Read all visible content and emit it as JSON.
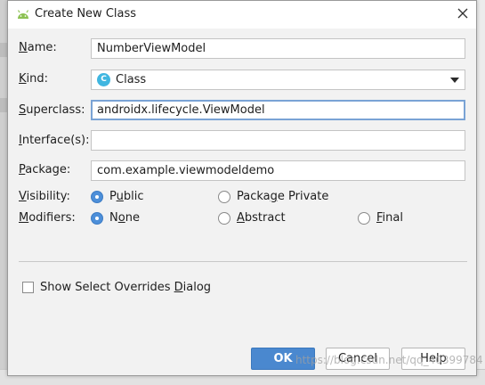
{
  "dialog": {
    "title": "Create New Class",
    "icon": "android-icon",
    "close_icon": "close-icon"
  },
  "form": {
    "name": {
      "label_u": "N",
      "label_rest": "ame:",
      "value": "NumberViewModel"
    },
    "kind": {
      "label_u": "K",
      "label_rest": "ind:",
      "value": "Class",
      "icon_glyph": "C",
      "icon_color": "#40b6e0"
    },
    "superclass": {
      "label_u": "S",
      "label_rest": "uperclass:",
      "value": "androidx.lifecycle.ViewModel"
    },
    "interfaces": {
      "label_u": "I",
      "label_rest": "nterface(s):",
      "value": ""
    },
    "package": {
      "label_u": "P",
      "label_rest": "ackage:",
      "value": "com.example.viewmodeldemo"
    }
  },
  "visibility": {
    "label_u": "V",
    "label_rest": "isibility:",
    "options": [
      {
        "pre": "P",
        "u": "u",
        "post": "blic",
        "checked": true
      },
      {
        "pre": "Packa",
        "u": "g",
        "post": "e Private",
        "checked": false
      }
    ]
  },
  "modifiers": {
    "label_u": "M",
    "label_rest": "odifiers:",
    "options": [
      {
        "pre": "N",
        "u": "o",
        "post": "ne",
        "checked": true
      },
      {
        "pre": "",
        "u": "A",
        "post": "bstract",
        "checked": false
      },
      {
        "pre": "",
        "u": "F",
        "post": "inal",
        "checked": false
      }
    ]
  },
  "overrides": {
    "pre": "Show Select Overrides ",
    "u": "D",
    "post": "ialog",
    "checked": false
  },
  "buttons": {
    "ok": "OK",
    "cancel": "Cancel",
    "help": "Help"
  },
  "watermark": "https://blog.csdn.net/qq_40399784",
  "colors": {
    "accent": "#4a88cf",
    "radio_checked": "#4d8fd9",
    "focus_border": "#7aa3d5"
  }
}
